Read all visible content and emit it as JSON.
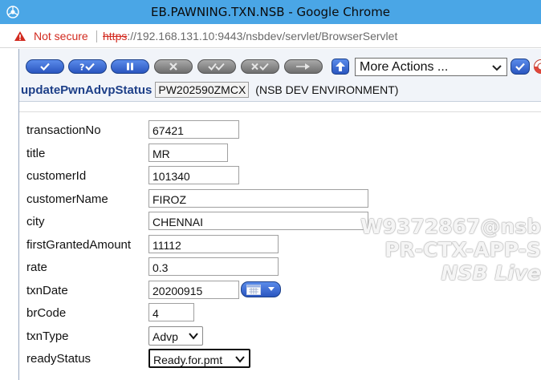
{
  "window": {
    "title": "EB.PAWNING.TXN.NSB - Google Chrome"
  },
  "address_bar": {
    "security_label": "Not secure",
    "url_scheme": "https",
    "url_rest": "://192.168.131.10:9443/nsbdev/servlet/BrowserServlet"
  },
  "toolbar": {
    "buttons": [
      {
        "icon": "check-icon",
        "state": "active"
      },
      {
        "icon": "question-check-icon",
        "state": "active"
      },
      {
        "icon": "pause-icon",
        "state": "active"
      },
      {
        "icon": "x-icon",
        "state": "disabled"
      },
      {
        "icon": "double-check-icon",
        "state": "disabled"
      },
      {
        "icon": "x-check-icon",
        "state": "disabled"
      },
      {
        "icon": "next-icon",
        "state": "disabled"
      }
    ],
    "more_actions": "More Actions ...",
    "accent_color": "#2a56c0"
  },
  "context": {
    "function_name": "updatePwnAdvpStatus",
    "record_id": "PW202590ZMCX",
    "environment": "(NSB DEV ENVIRONMENT)"
  },
  "form": {
    "fields": [
      {
        "label": "transactionNo",
        "value": "67421"
      },
      {
        "label": "title",
        "value": "MR"
      },
      {
        "label": "customerId",
        "value": "101340"
      },
      {
        "label": "customerName",
        "value": "FIROZ"
      },
      {
        "label": "city",
        "value": "CHENNAI"
      },
      {
        "label": "firstGrantedAmount",
        "value": "11112"
      },
      {
        "label": "rate",
        "value": "0.3"
      },
      {
        "label": "txnDate",
        "value": "20200915"
      },
      {
        "label": "brCode",
        "value": "4"
      },
      {
        "label": "txnType",
        "value": "Advp"
      },
      {
        "label": "readyStatus",
        "value": "Ready.for.pmt"
      }
    ]
  },
  "watermark": {
    "line1": "W9372867@nsb",
    "line2": "PR-CTX-APP-S",
    "line3": "NSB Live"
  }
}
